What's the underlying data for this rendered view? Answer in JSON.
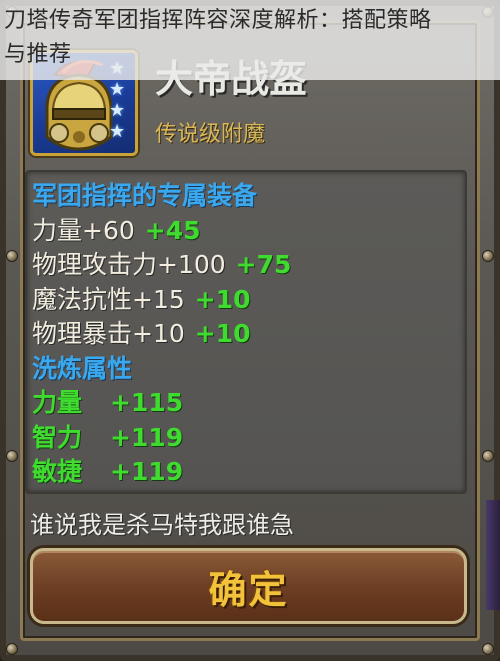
{
  "caption": {
    "line1": "刀塔传奇军团指挥阵容深度解析：搭配策略",
    "line2": "与推荐"
  },
  "item": {
    "name": "大帝战盔",
    "grade": "传说级附魔",
    "stars": [
      "★",
      "★",
      "★",
      "★"
    ],
    "icon": "helmet-icon"
  },
  "stats": {
    "section_title": "军团指挥的专属装备",
    "rows": [
      {
        "base": "力量+60",
        "bonus": "+45"
      },
      {
        "base": "物理攻击力+100",
        "bonus": "+75"
      },
      {
        "base": "魔法抗性+15",
        "bonus": "+10"
      },
      {
        "base": "物理暴击+10",
        "bonus": "+10"
      }
    ],
    "refine_title": "洗炼属性",
    "refine": [
      {
        "name": "力量",
        "value": "+115"
      },
      {
        "name": "智力",
        "value": "+119"
      },
      {
        "name": "敏捷",
        "value": "+119"
      }
    ]
  },
  "flavor_text": "谁说我是杀马特我跟谁急",
  "confirm_label": "确定",
  "colors": {
    "section_blue": "#39a8ee",
    "bonus_green": "#3fdc2f",
    "button_gold": "#f2c23a"
  }
}
